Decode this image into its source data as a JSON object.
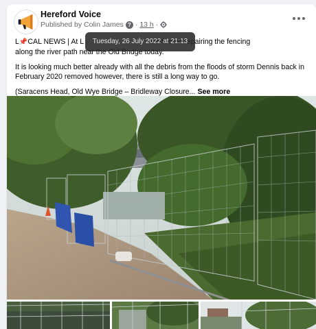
{
  "post": {
    "page_name": "Hereford Voice",
    "published_by": "Published by Colin James",
    "time": "13 h",
    "separator": "·",
    "help_icon": "?",
    "tooltip": "Tuesday, 26 July 2022 at 21:13",
    "audience_icon": "gear-icon",
    "more_icon": "ellipsis-icon",
    "paragraph1_prefix": "L",
    "paragraph1_icon": "pin-icon",
    "paragraph1_after_icon": "CAL NEWS | At L",
    "paragraph1_hidden": "",
    "paragraph1_tail": "started on repairing the fencing",
    "paragraph1_line2": "along the river path near the Old Bridge today.",
    "paragraph2": "It is looking much better already with all the debris from the floods of storm Dennis back in February 2020 removed however, there is still a long way to go.",
    "paragraph3": "(Saracens Head, Old Wye Bridge – Bridleway Closure...",
    "see_more": "See more"
  },
  "colors": {
    "background": "#f0f2f5",
    "card": "#ffffff",
    "secondary_text": "#65676b",
    "tooltip_bg": "#282828"
  }
}
